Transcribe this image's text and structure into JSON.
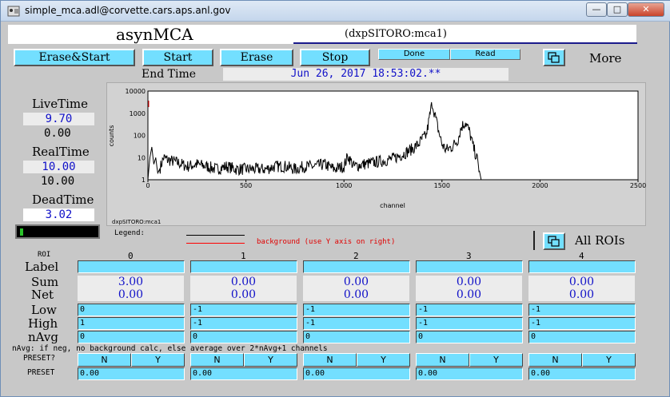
{
  "window": {
    "title": "simple_mca.adl@corvette.cars.aps.anl.gov",
    "min_label": "—",
    "max_label": "□",
    "close_label": "✕"
  },
  "header": {
    "app_title": "asynMCA",
    "record_name": "(dxpSITORO:mca1)"
  },
  "toolbar": {
    "erase_start": "Erase&Start",
    "start": "Start",
    "erase": "Erase",
    "stop": "Stop",
    "status_done": "Done",
    "status_read": "Read",
    "more": "More"
  },
  "endtime": {
    "label": "End Time",
    "value": "Jun 26, 2017 18:53:02.**"
  },
  "left": {
    "livetime_label": "LiveTime",
    "livetime_set": "9.70",
    "livetime_val": "0.00",
    "realtime_label": "RealTime",
    "realtime_set": "10.00",
    "realtime_val": "10.00",
    "deadtime_label": "DeadTime",
    "deadtime_val": "3.02"
  },
  "plot": {
    "ylabel": "counts",
    "xlabel": "channel",
    "footer": "dxpSITORO:mca1",
    "legend_label": "Legend:",
    "legend_bg": "background (use Y axis on right)",
    "all_rois": "All ROIs",
    "accent_color": "#ff0000"
  },
  "chart_data": {
    "type": "line",
    "title": "",
    "xlabel": "channel",
    "ylabel": "counts",
    "xlim": [
      0,
      2500
    ],
    "ylim": [
      1,
      10000
    ],
    "yscale": "log",
    "x_ticks": [
      "0",
      "500",
      "1000",
      "1500",
      "2000",
      "2500"
    ],
    "y_ticks": [
      "10000",
      "1000",
      "100",
      "10",
      "1"
    ],
    "series": [
      {
        "x": [
          0,
          10,
          20,
          30,
          40,
          50,
          60,
          80,
          100,
          150,
          200,
          250,
          300,
          350,
          400,
          450,
          500,
          550,
          600,
          650,
          700,
          750,
          800,
          850,
          900,
          950,
          1000,
          1020,
          1050,
          1100,
          1150,
          1200,
          1250,
          1300,
          1350,
          1380,
          1400,
          1420,
          1440,
          1450,
          1460,
          1480,
          1500,
          1520,
          1550,
          1580,
          1600,
          1620,
          1640,
          1660,
          1680,
          1700,
          1750,
          1800,
          1900,
          2000,
          2100,
          2200,
          2300,
          2400,
          2500
        ],
        "y": [
          1,
          10,
          30,
          5,
          10,
          2,
          3,
          10,
          8,
          6,
          4,
          5,
          4,
          3,
          4,
          3,
          3,
          3,
          3,
          4,
          4,
          3,
          4,
          4,
          5,
          3,
          4,
          12,
          4,
          5,
          6,
          7,
          9,
          14,
          25,
          40,
          70,
          100,
          1000,
          3000,
          1200,
          200,
          40,
          22,
          30,
          60,
          250,
          400,
          150,
          30,
          8,
          1,
          1,
          1,
          1,
          1,
          1,
          1,
          1,
          1,
          1
        ]
      }
    ]
  },
  "rois": {
    "header_label": "ROI",
    "row_labels": {
      "label": "Label",
      "sum": "Sum",
      "net": "Net",
      "low": "Low",
      "high": "High",
      "navg": "nAvg",
      "preset_q": "PRESET?",
      "preset": "PRESET"
    },
    "navg_note": "nAvg: if neg, no background calc, else average over 2*nAvg+1 channels",
    "yes": "Y",
    "no": "N",
    "columns": [
      {
        "index": "0",
        "label": "",
        "sum": "3.00",
        "net": "0.00",
        "low": "0",
        "high": "1",
        "navg": "0",
        "preset": "0.00"
      },
      {
        "index": "1",
        "label": "",
        "sum": "0.00",
        "net": "0.00",
        "low": "-1",
        "high": "-1",
        "navg": "0",
        "preset": "0.00"
      },
      {
        "index": "2",
        "label": "",
        "sum": "0.00",
        "net": "0.00",
        "low": "-1",
        "high": "-1",
        "navg": "0",
        "preset": "0.00"
      },
      {
        "index": "3",
        "label": "",
        "sum": "0.00",
        "net": "0.00",
        "low": "-1",
        "high": "-1",
        "navg": "0",
        "preset": "0.00"
      },
      {
        "index": "4",
        "label": "",
        "sum": "0.00",
        "net": "0.00",
        "low": "-1",
        "high": "-1",
        "navg": "0",
        "preset": "0.00"
      }
    ]
  }
}
